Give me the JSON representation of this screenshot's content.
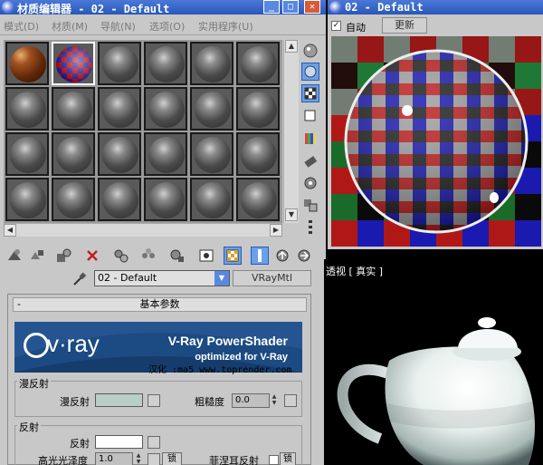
{
  "material_editor": {
    "title": "材质编辑器 - 02 - Default",
    "menu": [
      "模式(D)",
      "材质(M)",
      "导航(N)",
      "选项(O)",
      "实用程序(U)"
    ],
    "material_name": "02 - Default",
    "material_type": "VRayMtl",
    "rollout_title": "基本参数",
    "rollout_collapse": "-",
    "banner": {
      "brand": "v·ray",
      "title": "V-Ray PowerShader",
      "subtitle": "optimized for V-Ray",
      "credit": "汉化 :ma5 www.toprender.com"
    },
    "diffuse_group": {
      "title": "漫反射",
      "diffuse_label": "漫反射",
      "diffuse_color": "#b8cec6",
      "roughness_label": "粗糙度",
      "roughness_value": "0.0"
    },
    "reflect_group": {
      "title": "反射",
      "reflect_label": "反射",
      "reflect_color": "#ffffff",
      "glossiness_label": "高光光泽度",
      "glossiness_value": "1.0",
      "lock_label": "锁",
      "fresnel_label": "菲涅耳反射",
      "fresnel_lock_label": "锁"
    },
    "scrollbar_arrows": {
      "up": "▲",
      "down": "▼",
      "left": "◀",
      "right": "▶"
    }
  },
  "preview_window": {
    "title": "02 - Default",
    "auto_label": "自动",
    "auto_checked": true,
    "update_label": "更新"
  },
  "viewport": {
    "label": "透视 [ 真实 ]"
  }
}
